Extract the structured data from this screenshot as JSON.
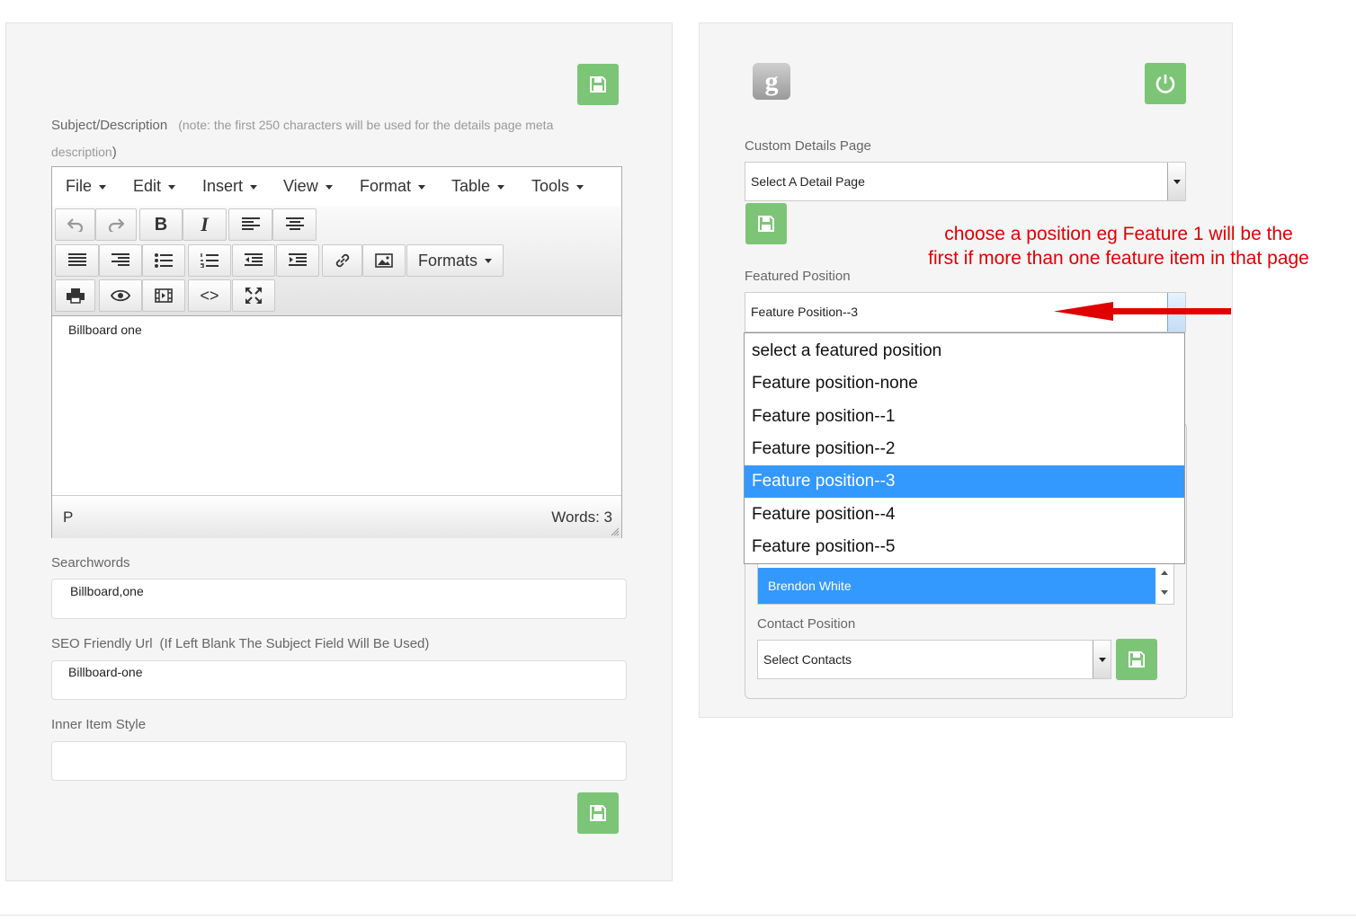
{
  "left_panel": {
    "subject": {
      "label": "Subject/Description",
      "note_line1": "(note: the first 250 characters will be used for the details page meta",
      "note_line2_a": "description",
      "note_line2_b": ")"
    },
    "editor": {
      "menu": [
        "File",
        "Edit",
        "Insert",
        "View",
        "Format",
        "Table",
        "Tools"
      ],
      "formats_label": "Formats",
      "content": "Billboard one",
      "status_path": "P",
      "word_count": "Words: 3"
    },
    "searchwords": {
      "label": "Searchwords",
      "value": "Billboard,one"
    },
    "seo_url": {
      "label": "SEO Friendly Url",
      "note": "(If Left Blank The Subject Field Will Be Used)",
      "value": "Billboard-one"
    },
    "inner_item_style": {
      "label": "Inner Item Style",
      "value": ""
    }
  },
  "right_panel": {
    "custom_details_page": {
      "label": "Custom Details Page",
      "selected": "Select A Detail Page"
    },
    "featured_position": {
      "label": "Featured Position",
      "selected": "Feature Position--3",
      "options": [
        "select a featured position",
        "Feature position-none",
        "Feature position--1",
        "Feature position--2",
        "Feature position--3",
        "Feature position--4",
        "Feature position--5"
      ],
      "highlighted_index": 4
    },
    "contact_list": {
      "selected": "Brendon White"
    },
    "contact_position": {
      "label": "Contact Position",
      "selected": "Select Contacts"
    }
  },
  "annotation": {
    "line1": "choose a position eg Feature 1 will be the",
    "line2": "first if more than one feature item in that page",
    "color": "#e00000"
  },
  "colors": {
    "accent_green": "#7cc576",
    "selection_blue": "#3399ff"
  }
}
